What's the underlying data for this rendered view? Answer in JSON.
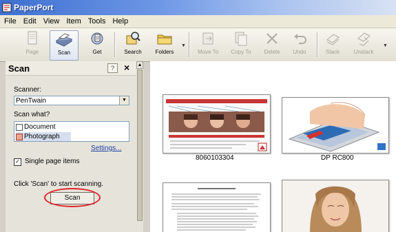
{
  "window": {
    "title": "PaperPort"
  },
  "menu": [
    "File",
    "Edit",
    "View",
    "Item",
    "Tools",
    "Help"
  ],
  "toolbar": {
    "page": "Page",
    "scan": "Scan",
    "get": "Get",
    "search": "Search",
    "folders": "Folders",
    "move_to": "Move To",
    "copy_to": "Copy To",
    "delete": "Delete",
    "undo": "Undo",
    "stack": "Stack",
    "unstack": "Unstack"
  },
  "scan_pane": {
    "title": "Scan",
    "help": "?",
    "close": "×",
    "scanner_label": "Scanner:",
    "scanner_value": "PenTwain",
    "scan_what_label": "Scan what?",
    "options": [
      "Document",
      "Photograph"
    ],
    "settings_link": "Settings...",
    "single_page_label": "Single page items",
    "single_page_checked": "✓",
    "instruction": "Click 'Scan' to start scanning.",
    "scan_button": "Scan"
  },
  "thumbnails": [
    {
      "caption": "8060103304"
    },
    {
      "caption": "DP RC800"
    },
    {
      "caption": ""
    },
    {
      "caption": ""
    }
  ],
  "colors": {
    "titlebar": "#3e6fd0",
    "highlight_ring": "#e1222a",
    "link": "#1a3fa8"
  }
}
